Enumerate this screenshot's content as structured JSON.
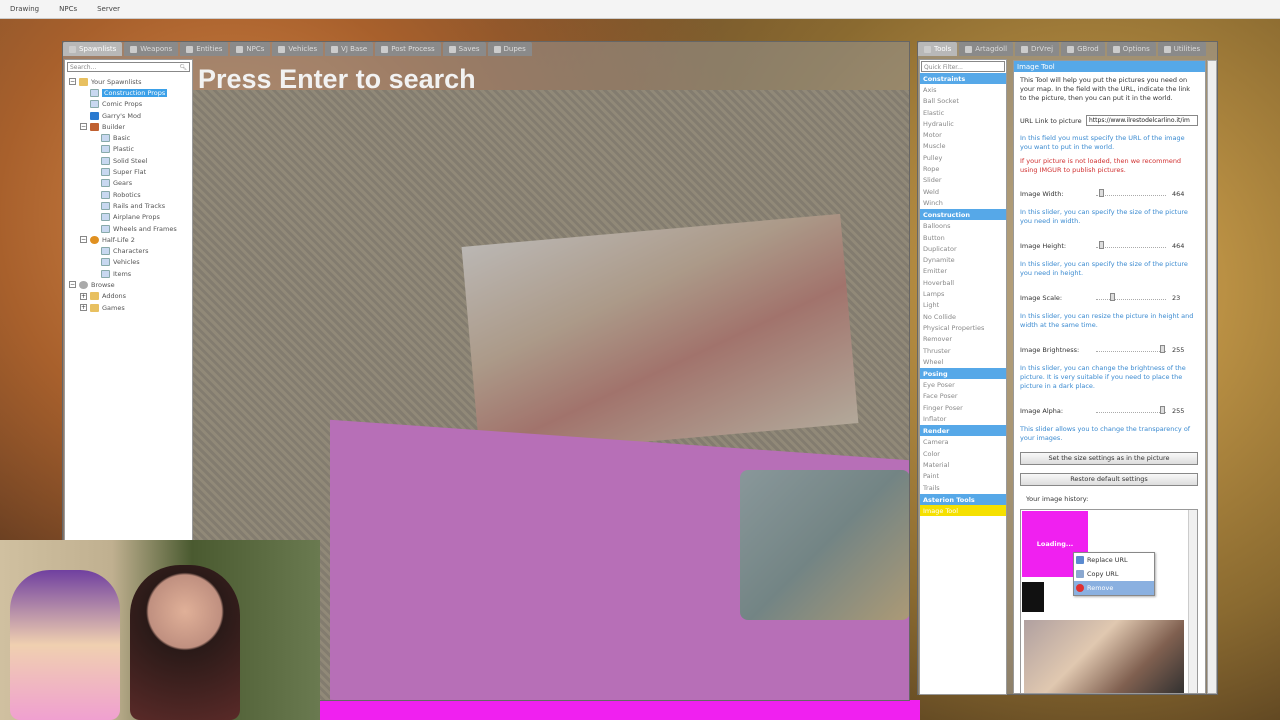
{
  "menubar": {
    "items": [
      "Drawing",
      "NPCs",
      "Server"
    ]
  },
  "spawnmenu": {
    "tabs": [
      "Spawnlists",
      "Weapons",
      "Entities",
      "NPCs",
      "Vehicles",
      "VJ Base",
      "Post Process",
      "Saves",
      "Dupes"
    ],
    "search_placeholder": "Search...",
    "search_hint": "Press Enter to search",
    "tree": [
      {
        "label": "Your Spawnlists",
        "indent": 0,
        "toggle": "−",
        "icon": "folder"
      },
      {
        "label": "Construction Props",
        "indent": 1,
        "icon": "page",
        "selected": true
      },
      {
        "label": "Comic Props",
        "indent": 1,
        "icon": "page"
      },
      {
        "label": "Garry's Mod",
        "indent": 1,
        "icon": "g"
      },
      {
        "label": "Builder",
        "indent": 1,
        "toggle": "−",
        "icon": "tool"
      },
      {
        "label": "Basic",
        "indent": 2,
        "icon": "page"
      },
      {
        "label": "Plastic",
        "indent": 2,
        "icon": "page"
      },
      {
        "label": "Solid Steel",
        "indent": 2,
        "icon": "page"
      },
      {
        "label": "Super Flat",
        "indent": 2,
        "icon": "page"
      },
      {
        "label": "Gears",
        "indent": 2,
        "icon": "page"
      },
      {
        "label": "Robotics",
        "indent": 2,
        "icon": "page"
      },
      {
        "label": "Rails and Tracks",
        "indent": 2,
        "icon": "page"
      },
      {
        "label": "Airplane Props",
        "indent": 2,
        "icon": "page"
      },
      {
        "label": "Wheels and Frames",
        "indent": 2,
        "icon": "page"
      },
      {
        "label": "Half-Life 2",
        "indent": 1,
        "toggle": "−",
        "icon": "hl"
      },
      {
        "label": "Characters",
        "indent": 2,
        "icon": "page"
      },
      {
        "label": "Vehicles",
        "indent": 2,
        "icon": "page"
      },
      {
        "label": "Items",
        "indent": 2,
        "icon": "page"
      },
      {
        "label": "Browse",
        "indent": 0,
        "toggle": "−",
        "icon": "globe"
      },
      {
        "label": "Addons",
        "indent": 1,
        "toggle": "+",
        "icon": "folder"
      },
      {
        "label": "Games",
        "indent": 1,
        "toggle": "+",
        "icon": "folder"
      }
    ]
  },
  "toolmenu": {
    "tabs": [
      "Tools",
      "Artagdoll",
      "DrVrej",
      "GBrod",
      "Options",
      "Utilities"
    ],
    "quick_filter": "Quick Filter...",
    "categories": [
      {
        "name": "Constraints",
        "items": [
          "Axis",
          "Ball Socket",
          "Elastic",
          "Hydraulic",
          "Motor",
          "Muscle",
          "Pulley",
          "Rope",
          "Slider",
          "Weld",
          "Winch"
        ]
      },
      {
        "name": "Construction",
        "items": [
          "Balloons",
          "Button",
          "Duplicator",
          "Dynamite",
          "Emitter",
          "Hoverball",
          "Lamps",
          "Light",
          "No Collide",
          "Physical Properties",
          "Remover",
          "Thruster",
          "Wheel"
        ]
      },
      {
        "name": "Posing",
        "items": [
          "Eye Poser",
          "Face Poser",
          "Finger Poser",
          "Inflator"
        ]
      },
      {
        "name": "Render",
        "items": [
          "Camera",
          "Color",
          "Material",
          "Paint",
          "Trails"
        ]
      },
      {
        "name": "Asterion Tools",
        "items": [
          "Image Tool"
        ]
      }
    ],
    "selected_tool": "Image Tool"
  },
  "panel": {
    "title": "Image Tool",
    "intro": "This Tool will help you put the pictures you need on your map. In the field with the URL, indicate the link to the picture, then you can put it in the world.",
    "url_label": "URL Link to picture",
    "url_value": "https://www.ilrestodelcarlino.it/im",
    "url_help": "In this field you must specify the URL of the image you want to put in the world.",
    "url_warn": "If your picture is not loaded, then we recommend using IMGUR to publish pictures.",
    "sliders": [
      {
        "label": "Image Width:",
        "value": "464",
        "level": 0.05,
        "help": "In this slider, you can specify the size of the picture you need in width."
      },
      {
        "label": "Image Height:",
        "value": "464",
        "level": 0.05,
        "help": "In this slider, you can specify the size of the picture you need in height."
      },
      {
        "label": "Image Scale:",
        "value": "23",
        "level": 0.22,
        "help": "In this slider, you can resize the picture in height and width at the same time."
      },
      {
        "label": "Image Brightness:",
        "value": "255",
        "level": 1.0,
        "help": "In this slider, you can change the brightness of the picture. It is very suitable if you need to place the picture in a dark place."
      },
      {
        "label": "Image Alpha:",
        "value": "255",
        "level": 1.0,
        "help": "This slider allows you to change the transparency of your images."
      }
    ],
    "btn_set_size": "Set the size settings as in the picture",
    "btn_restore": "Restore default settings",
    "history_label": "Your image history:",
    "loading": "Loading...",
    "context_menu": [
      "Replace URL",
      "Copy URL",
      "Remove"
    ]
  }
}
